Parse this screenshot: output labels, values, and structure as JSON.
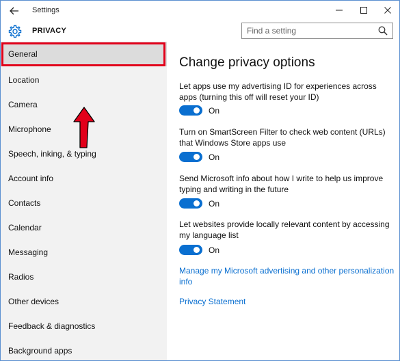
{
  "window": {
    "title": "Settings"
  },
  "header": {
    "title": "PRIVACY",
    "search_placeholder": "Find a setting"
  },
  "sidebar": {
    "items": [
      {
        "label": "General"
      },
      {
        "label": "Location"
      },
      {
        "label": "Camera"
      },
      {
        "label": "Microphone"
      },
      {
        "label": "Speech, inking, & typing"
      },
      {
        "label": "Account info"
      },
      {
        "label": "Contacts"
      },
      {
        "label": "Calendar"
      },
      {
        "label": "Messaging"
      },
      {
        "label": "Radios"
      },
      {
        "label": "Other devices"
      },
      {
        "label": "Feedback & diagnostics"
      },
      {
        "label": "Background apps"
      }
    ],
    "selected": "General"
  },
  "main": {
    "title": "Change privacy options",
    "settings": [
      {
        "description": "Let apps use my advertising ID for experiences across apps (turning this off will reset your ID)",
        "state": "On"
      },
      {
        "description": "Turn on SmartScreen Filter to check web content (URLs) that Windows Store apps use",
        "state": "On"
      },
      {
        "description": "Send Microsoft info about how I write to help us improve typing and writing in the future",
        "state": "On"
      },
      {
        "description": "Let websites provide locally relevant content by accessing my language list",
        "state": "On"
      }
    ],
    "links": [
      {
        "label": "Manage my Microsoft advertising and other personalization info"
      },
      {
        "label": "Privacy Statement"
      }
    ]
  },
  "colors": {
    "accent": "#0a6fd0",
    "highlight": "#e2001a",
    "sidebar_bg": "#f2f2f2"
  }
}
